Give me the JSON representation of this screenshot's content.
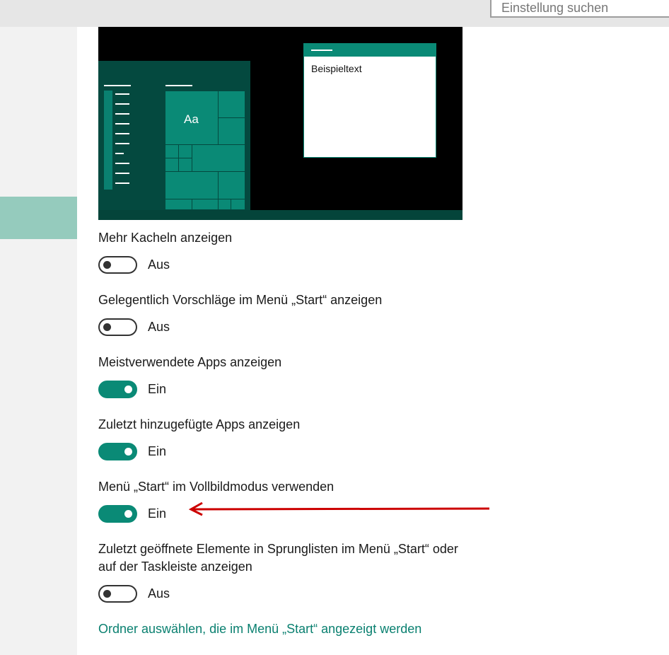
{
  "search": {
    "placeholder": "Einstellung suchen"
  },
  "preview": {
    "tile_label": "Aa",
    "window_text": "Beispieltext"
  },
  "settings": [
    {
      "label": "Mehr Kacheln anzeigen",
      "state": "Aus",
      "on": false
    },
    {
      "label": "Gelegentlich Vorschläge im Menü „Start“ anzeigen",
      "state": "Aus",
      "on": false
    },
    {
      "label": "Meistverwendete Apps anzeigen",
      "state": "Ein",
      "on": true
    },
    {
      "label": "Zuletzt hinzugefügte Apps anzeigen",
      "state": "Ein",
      "on": true
    },
    {
      "label": "Menü „Start“ im Vollbildmodus verwenden",
      "state": "Ein",
      "on": true
    },
    {
      "label_line1": "Zuletzt geöffnete Elemente in Sprunglisten im Menü „Start“ oder",
      "label_line2": "auf der Taskleiste anzeigen",
      "state": "Aus",
      "on": false
    }
  ],
  "link": {
    "text": "Ordner auswählen, die im Menü „Start“ angezeigt werden"
  },
  "colors": {
    "accent": "#0a8a76",
    "sidebar_selected": "#95cbbd",
    "arrow": "#cc0000"
  }
}
